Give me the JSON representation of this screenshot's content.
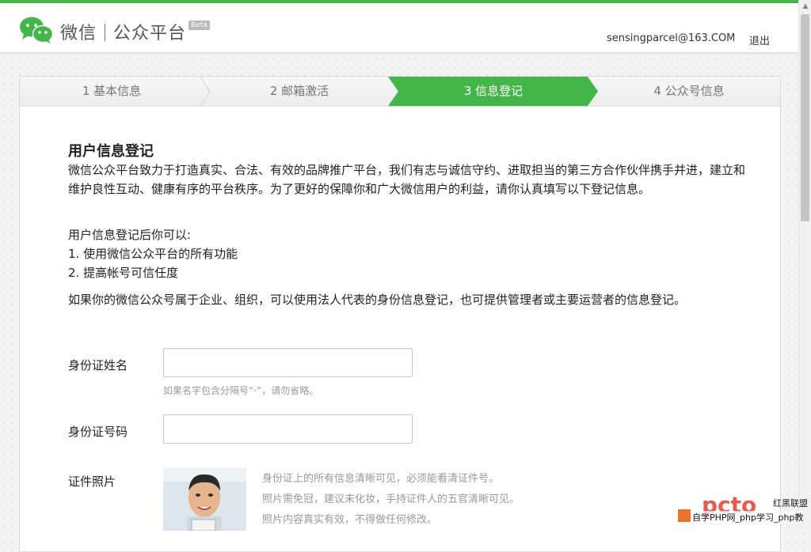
{
  "header": {
    "brand_name": "微信",
    "brand_sub": "公众平台",
    "beta": "Beta",
    "user_email": "sensingparcel@163.COM",
    "logout": "退出"
  },
  "steps": [
    {
      "label": "1 基本信息",
      "active": false
    },
    {
      "label": "2 邮箱激活",
      "active": false
    },
    {
      "label": "3 信息登记",
      "active": true
    },
    {
      "label": "4 公众号信息",
      "active": false
    }
  ],
  "content": {
    "title": "用户信息登记",
    "intro": "微信公众平台致力于打造真实、合法、有效的品牌推广平台，我们有志与诚信守约、进取担当的第三方合作伙伴携手并进，建立和维护良性互动、健康有序的平台秩序。为了更好的保障你和广大微信用户的利益，请你认真填写以下登记信息。",
    "after_title": "用户信息登记后你可以:",
    "benefit_1": "1. 使用微信公众平台的所有功能",
    "benefit_2": "2. 提高帐号可信任度",
    "org_note": "如果你的微信公众号属于企业、组织，可以使用法人代表的身份信息登记，也可提供管理者或主要运营者的信息登记。"
  },
  "form": {
    "id_name_label": "身份证姓名",
    "id_name_value": "",
    "id_name_hint": "如果名字包含分隔号“·”，请勿省略。",
    "id_number_label": "身份证号码",
    "id_number_value": "",
    "photo_label": "证件照片",
    "photo_notes": [
      "身份证上的所有信息清晰可见，必须能看清证件号。",
      "照片需免冠，建议未化妆，手持证件人的五官清晰可见。",
      "照片内容真实有效，不得做任何修改。"
    ]
  },
  "watermark": {
    "logo": "pcto",
    "top_text": "红黑联盟",
    "text": "自学PHP网_php学习_php教"
  },
  "colors": {
    "accent": "#44b549",
    "text": "#222222",
    "hint": "#999999"
  }
}
